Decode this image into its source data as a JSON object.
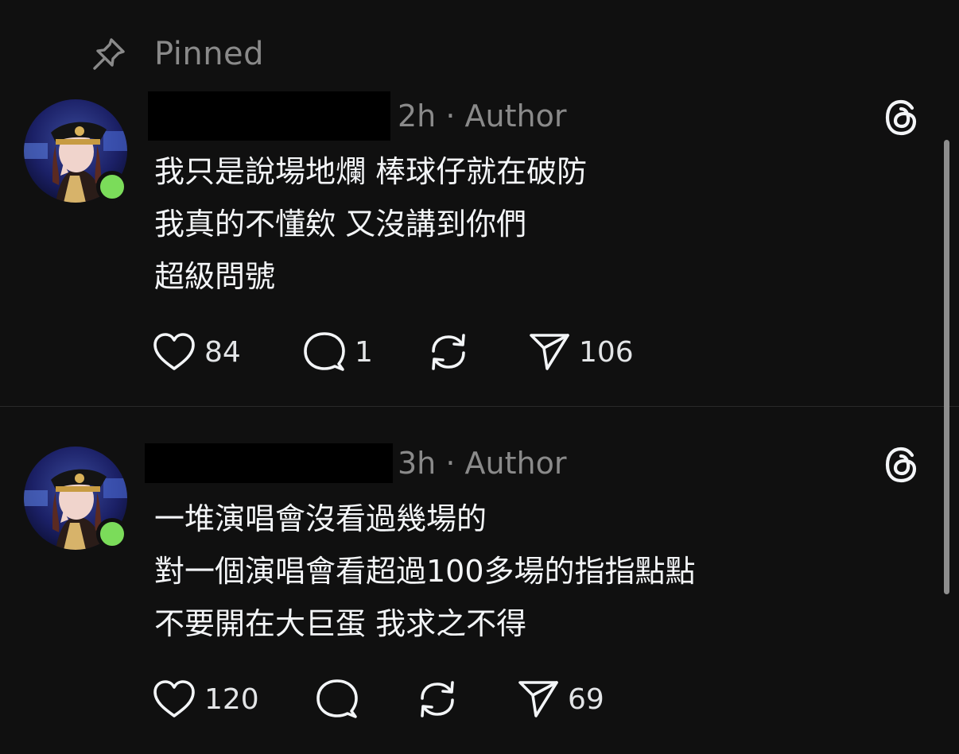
{
  "pinned": {
    "label": "Pinned",
    "icon": "pin-icon"
  },
  "colors": {
    "background": "#101010",
    "text_primary": "#f3f5f7",
    "text_secondary": "#8a8a8a",
    "online": "#7bdc5a"
  },
  "posts": [
    {
      "time": "2h",
      "separator": "·",
      "role": "Author",
      "lines": [
        "我只是說場地爛 棒球仔就在破防",
        "我真的不懂欸 又沒講到你們",
        "超級問號"
      ],
      "likes": "84",
      "replies": "1",
      "reposts": "",
      "shares": "106"
    },
    {
      "time": "3h",
      "separator": "·",
      "role": "Author",
      "lines": [
        "一堆演唱會沒看過幾場的",
        "對一個演唱會看超過100多場的指指點點",
        "不要開在大巨蛋 我求之不得"
      ],
      "likes": "120",
      "replies": "",
      "reposts": "",
      "shares": "69"
    }
  ]
}
